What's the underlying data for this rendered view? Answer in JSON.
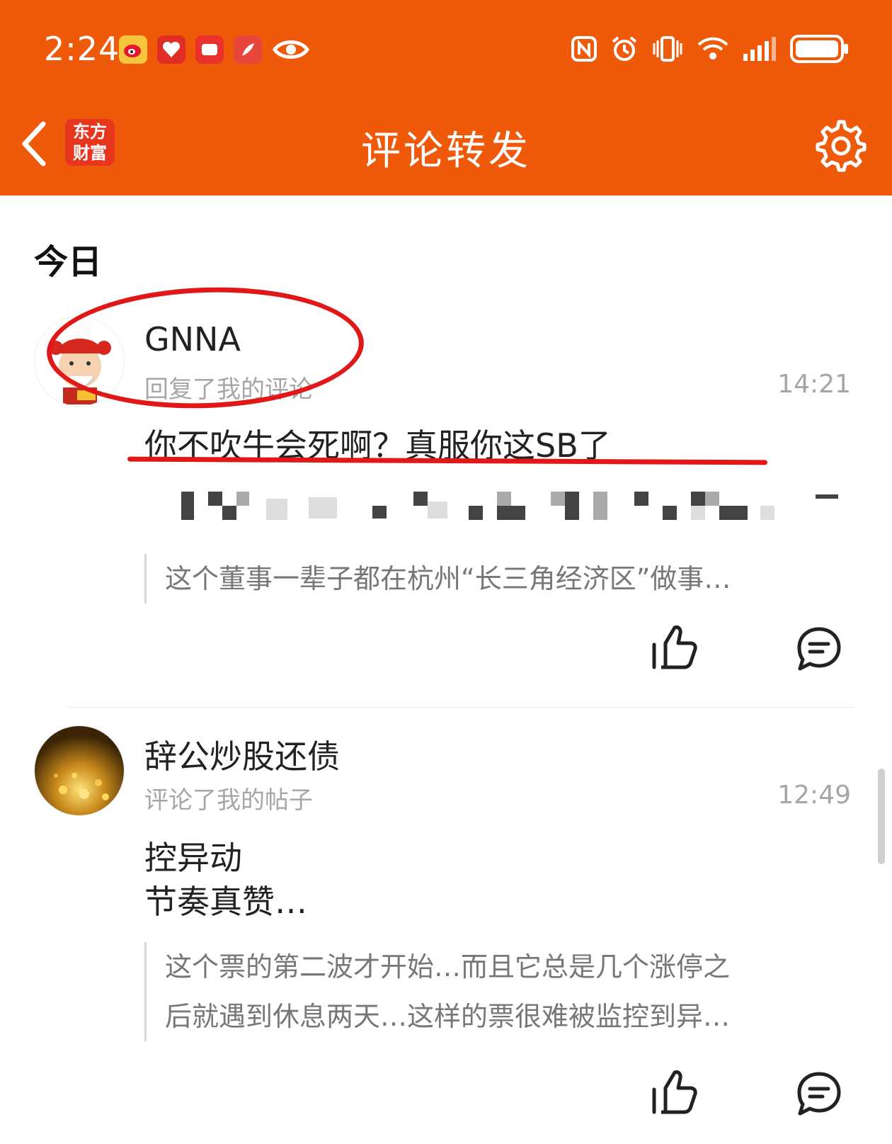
{
  "status_bar": {
    "time": "2:24",
    "notification_icons": [
      "weibo-icon",
      "pinduoduo-icon",
      "red-app-icon",
      "feather-app-icon",
      "eye-icon"
    ],
    "system_icons": [
      "nfc-icon",
      "alarm-icon",
      "vibrate-icon",
      "wifi-icon",
      "signal-icon",
      "battery-icon"
    ]
  },
  "header": {
    "brand_line1": "东方",
    "brand_line2": "财富",
    "title": "评论转发"
  },
  "section": {
    "label": "今日"
  },
  "items": [
    {
      "username": "GNNA",
      "action": "回复了我的评论",
      "time": "14:21",
      "comment": "你不吹牛会死啊？真服你这SB了",
      "quote_lines": [
        "这个董事一辈子都在杭州“长三角经济区”做事…"
      ]
    },
    {
      "username": "辞公炒股还债",
      "action": "评论了我的帖子",
      "time": "12:49",
      "comment_lines": [
        "控异动",
        "节奏真赞…"
      ],
      "quote_lines": [
        "这个票的第二波才开始…而且它总是几个涨停之",
        "后就遇到休息两天…这样的票很难被监控到异…"
      ]
    }
  ],
  "colors": {
    "header_bg": "#EE5A0A",
    "annotation_red": "#E01818",
    "muted_text": "#a6a6a6"
  }
}
